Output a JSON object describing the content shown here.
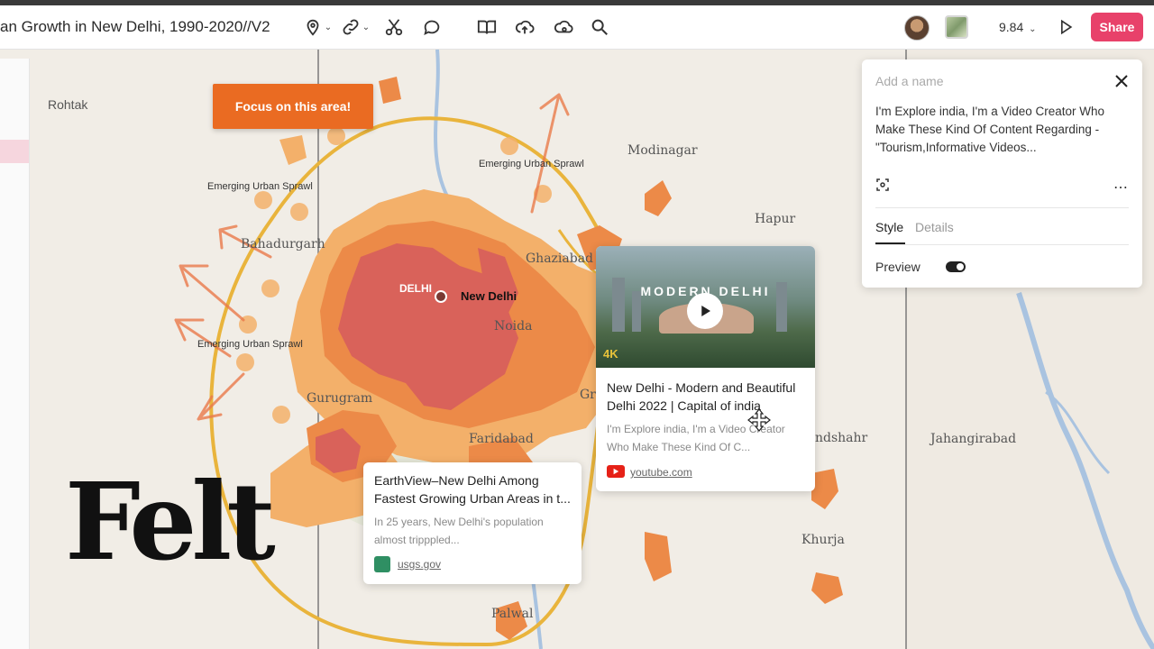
{
  "toolbar": {
    "doc_title": "an Growth in New Delhi, 1990-2020//V2",
    "zoom": "9.84",
    "share_label": "Share",
    "tools": [
      "pin-icon",
      "link-icon",
      "scissors-icon",
      "comment-icon",
      "book-icon",
      "upload-icon",
      "cloud-icon",
      "search-icon",
      "play-icon"
    ]
  },
  "map": {
    "focus_button": "Focus on this area!",
    "labels": {
      "rohtak": "Rohtak",
      "modinagar": "Modinagar",
      "hapur": "Hapur",
      "bahadurgarh": "Bahadurgarh",
      "ghaziabad": "Ghaziabad",
      "delhi": "DELHI",
      "new_delhi": "New Delhi",
      "noida": "Noida",
      "gurugram": "Gurugram",
      "faridabad": "Faridabad",
      "bulandshahr": "ndshahr",
      "jahangirabad": "Jahangirabad",
      "khurja": "Khurja",
      "palwal": "Palwal",
      "gr": "Gr",
      "sprawl_1": "Emerging Urban Sprawl",
      "sprawl_2": "Emerging Urban Sprawl",
      "sprawl_3": "Emerging Urban Sprawl"
    }
  },
  "cards": {
    "usgs": {
      "title": "EarthView–New Delhi Among Fastest Growing Urban Areas in t...",
      "description": "In 25 years, New Delhi's population almost tripppled...",
      "link": "usgs.gov"
    },
    "video": {
      "thumb_title": "MODERN DELHI",
      "thumb_badge": "4K",
      "title": "New Delhi - Modern and Beautiful Delhi 2022 | Capital of india",
      "description": "I'm Explore india, I'm a Video Creator Who Make These Kind Of C...",
      "link": "youtube.com"
    }
  },
  "side_panel": {
    "name_placeholder": "Add a name",
    "body_text": "I'm Explore india, I'm a Video Creator Who Make These Kind Of Content Regarding - \"Tourism,Informative Videos...",
    "tabs": [
      "Style",
      "Details"
    ],
    "preview_label": "Preview",
    "preview_on": true
  },
  "brand": {
    "logo_text": "Felt"
  },
  "colors": {
    "share": "#e8416a",
    "focus": "#ea6b22",
    "urban_core": "#d9625a",
    "urban_mid": "#ec8a48",
    "urban_outer": "#f3b06a",
    "ring_road": "#e9b43c",
    "river": "#a9c3e0"
  }
}
